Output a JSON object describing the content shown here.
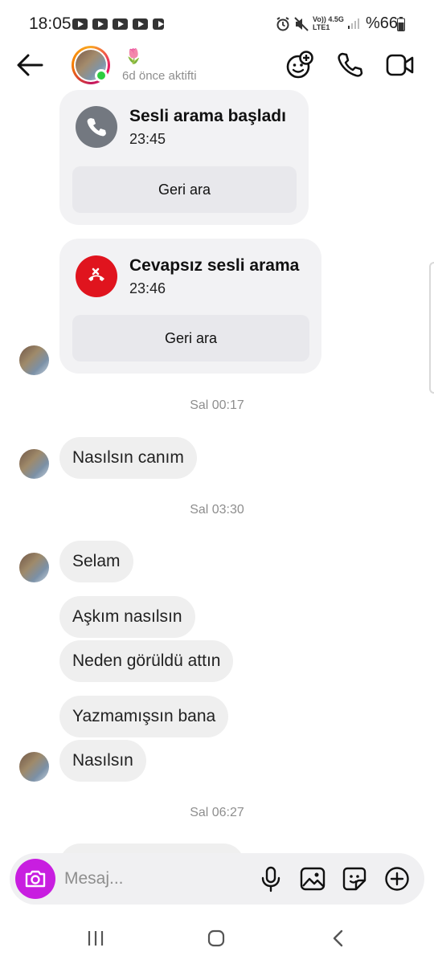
{
  "status_bar": {
    "time": "18:05",
    "right_text": "%66",
    "net": "Vo)) 4.5G",
    "lte": "LTE1"
  },
  "header": {
    "emoji": "🌷",
    "status": "6d önce aktifti"
  },
  "calls": [
    {
      "title": "Sesli arama başladı",
      "time": "23:45",
      "button": "Geri ara",
      "icon": "phone-icon",
      "color": "#737880"
    },
    {
      "title": "Cevapsız sesli arama",
      "time": "23:46",
      "button": "Geri ara",
      "icon": "missed-call-icon",
      "color": "#e0141e"
    }
  ],
  "timestamps": [
    "Sal 00:17",
    "Sal 03:30",
    "Sal 06:27"
  ],
  "messages": [
    "Nasılsın canım",
    "Selam",
    "Aşkım nasılsın",
    "Neden görüldü attın",
    "Yazmamışsın bana",
    "Nasılsın"
  ],
  "composer": {
    "placeholder": "Mesaj..."
  },
  "colors": {
    "accent": "#c81ee0",
    "online": "#2ecc40",
    "bubble": "#efefef"
  }
}
